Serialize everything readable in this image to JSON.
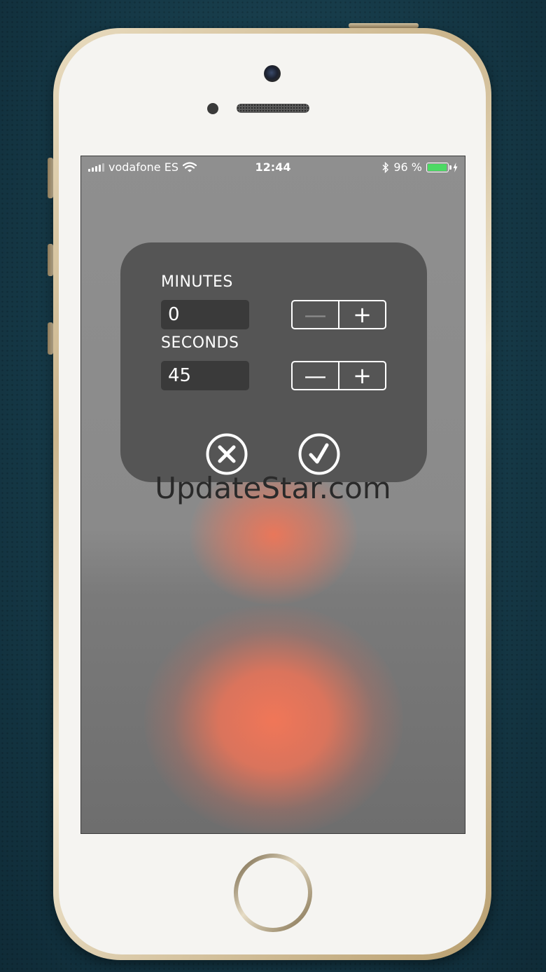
{
  "status_bar": {
    "carrier": "vodafone ES",
    "time": "12:44",
    "battery_percent": "96 %",
    "battery_level": 0.96,
    "icons": [
      "signal-icon",
      "wifi-icon",
      "bluetooth-icon",
      "battery-icon",
      "charging-icon"
    ]
  },
  "dialog": {
    "minutes": {
      "label": "MINUTES",
      "value": "0",
      "decrement": "—",
      "increment": "+"
    },
    "seconds": {
      "label": "SECONDS",
      "value": "45",
      "decrement": "—",
      "increment": "+"
    },
    "actions": [
      "cancel-icon",
      "confirm-icon"
    ]
  },
  "watermark": "UpdateStar.com",
  "colors": {
    "dialog_bg": "#555555",
    "field_bg": "#3a3a3a",
    "battery": "#4cd964",
    "blur_accent": "#ee7458"
  }
}
